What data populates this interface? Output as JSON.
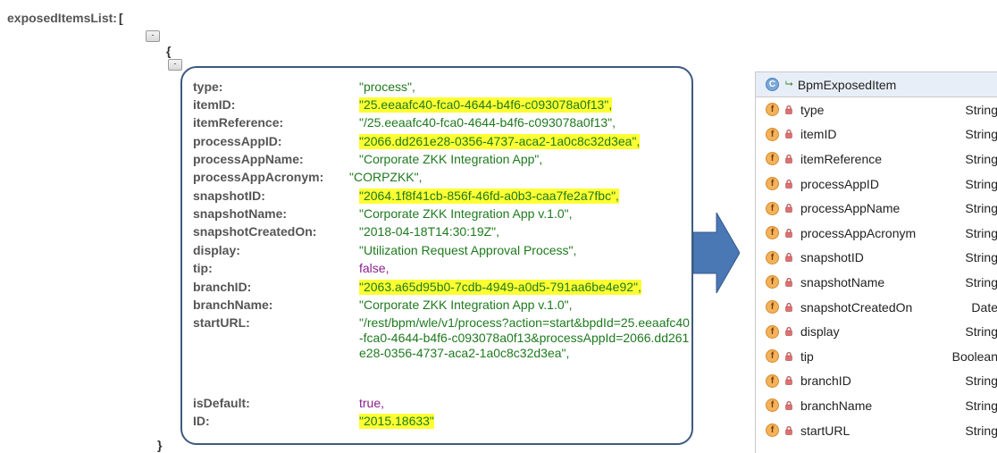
{
  "json_view": {
    "root_key": "exposedItemsList:",
    "open_bracket": "[",
    "open_brace": "{",
    "close_brace": "}",
    "collapse_label": "-",
    "rows": [
      {
        "key": "type:",
        "value": "\"process\",",
        "style": "str"
      },
      {
        "key": "itemID:",
        "value": "\"25.eeaafc40-fca0-4644-b4f6-c093078a0f13\",",
        "style": "hl"
      },
      {
        "key": "itemReference:",
        "value": "\"/25.eeaafc40-fca0-4644-b4f6-c093078a0f13\",",
        "style": "str"
      },
      {
        "key": "processAppID:",
        "value": "\"2066.dd261e28-0356-4737-aca2-1a0c8c32d3ea\",",
        "style": "hl"
      },
      {
        "key": "processAppName:",
        "value": "\"Corporate ZKK Integration App\",",
        "style": "str"
      },
      {
        "key": "processAppAcronym:",
        "value": "\"CORPZKK\",",
        "style": "str"
      },
      {
        "key": "snapshotID:",
        "value": "\"2064.1f8f41cb-856f-46fd-a0b3-caa7fe2a7fbc\",",
        "style": "hl"
      },
      {
        "key": "snapshotName:",
        "value": "\"Corporate ZKK Integration App v.1.0\",",
        "style": "str"
      },
      {
        "key": "snapshotCreatedOn:",
        "value": "\"2018-04-18T14:30:19Z\",",
        "style": "str"
      },
      {
        "key": "display:",
        "value": "\"Utilization Request Approval Process\",",
        "style": "str"
      },
      {
        "key": "tip:",
        "value": "false,",
        "style": "kw"
      },
      {
        "key": "branchID:",
        "value": "\"2063.a65d95b0-7cdb-4949-a0d5-791aa6be4e92\",",
        "style": "hl"
      },
      {
        "key": "branchName:",
        "value": "\"Corporate ZKK Integration App v.1.0\",",
        "style": "str"
      },
      {
        "key": "startURL:",
        "value": "\"/rest/bpm/wle/v1/process?action=start&bpdId=25.eeaafc40-fca0-4644-b4f6-c093078a0f13&processAppId=2066.dd261e28-0356-4737-aca2-1a0c8c32d3ea\",",
        "style": "wrap"
      },
      {
        "key": "isDefault:",
        "value": "true,",
        "style": "kw"
      },
      {
        "key": "ID:",
        "value": "\"2015.18633\"",
        "style": "hl"
      }
    ]
  },
  "class_view": {
    "class_icon": "class-icon",
    "class_icon_letter": "C",
    "class_name": "BpmExposedItem",
    "field_icon_letter": "f",
    "fields": [
      {
        "name": "type",
        "type": "String"
      },
      {
        "name": "itemID",
        "type": "String"
      },
      {
        "name": "itemReference",
        "type": "String"
      },
      {
        "name": "processAppID",
        "type": "String"
      },
      {
        "name": "processAppName",
        "type": "String"
      },
      {
        "name": "processAppAcronym",
        "type": "String"
      },
      {
        "name": "snapshotID",
        "type": "String"
      },
      {
        "name": "snapshotName",
        "type": "String"
      },
      {
        "name": "snapshotCreatedOn",
        "type": "Date"
      },
      {
        "name": "display",
        "type": "String"
      },
      {
        "name": "tip",
        "type": "Boolean"
      },
      {
        "name": "branchID",
        "type": "String"
      },
      {
        "name": "branchName",
        "type": "String"
      },
      {
        "name": "startURL",
        "type": "String"
      }
    ]
  },
  "colors": {
    "highlight": "#ffff33",
    "string_value": "#1e7a1e",
    "keyword_value": "#8a1f8a",
    "panel_border": "#3d5a80",
    "arrow": "#4a78b5"
  }
}
